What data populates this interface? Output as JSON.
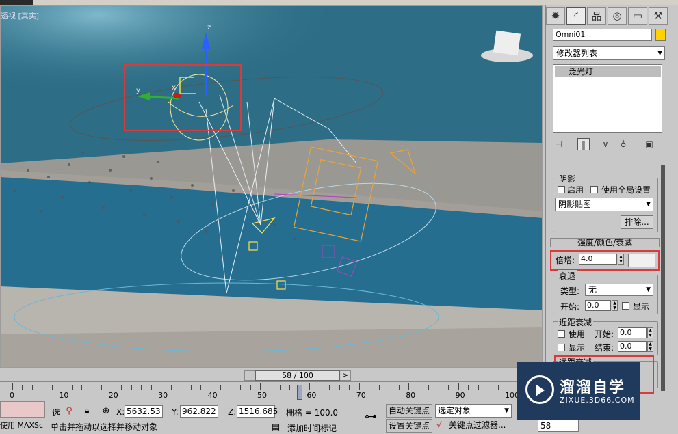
{
  "viewport": {
    "label_view": "透视",
    "label_mode": "[真实]",
    "axis_x": "x",
    "axis_y": "y",
    "axis_z": "z"
  },
  "command_panel": {
    "tabs": [
      "create-icon",
      "modify-icon",
      "hierarchy-icon",
      "motion-icon",
      "display-icon",
      "utilities-icon"
    ],
    "object_name": "Omni01",
    "object_color": "#ffd200",
    "modifier_list": "修改器列表",
    "stack_item": "泛光灯",
    "shadows": {
      "title": "阴影",
      "enabled_label": "启用",
      "global_label": "使用全局设置",
      "type": "阴影贴图",
      "exclude_button": "排除..."
    },
    "intensity": {
      "title": "强度/颜色/衰减",
      "multiplier_label": "倍增:",
      "multiplier_value": "4.0",
      "color": "#f0f0f0"
    },
    "decay": {
      "title": "衰退",
      "type_label": "类型:",
      "type_value": "无",
      "start_label": "开始:",
      "start_value": "0.0",
      "show_label": "显示"
    },
    "near_atten": {
      "title": "近距衰减",
      "use_label": "使用",
      "start_label": "开始:",
      "start_value": "0.0",
      "show_label": "显示",
      "end_label": "结束:",
      "end_value": "0.0"
    },
    "far_atten": {
      "title": "远距衰减"
    }
  },
  "timeline": {
    "frame_display": "58 / 100",
    "current_frame": 58,
    "total_frames": 100,
    "ticks": [
      "0",
      "10",
      "20",
      "30",
      "40",
      "50",
      "60",
      "70",
      "80",
      "90",
      "100"
    ]
  },
  "status": {
    "maxscript_label": "使用 MAXSc",
    "prompt": "单击并拖动以选择并移动对象",
    "x_label": "X:",
    "x_value": "5632.53",
    "y_label": "Y:",
    "y_value": "962.822",
    "z_label": "Z:",
    "z_value": "1516.685",
    "grid": "栅格 = 100.0",
    "add_time_tag": "添加时间标记",
    "auto_key": "自动关键点",
    "set_key": "设置关键点",
    "selected": "选定对象",
    "key_filters": "关键点过滤器...",
    "frame_field": "58",
    "fragment_left": "选"
  },
  "watermark": {
    "title": "溜溜自学",
    "url": "ZIXUE.3D66.COM"
  }
}
